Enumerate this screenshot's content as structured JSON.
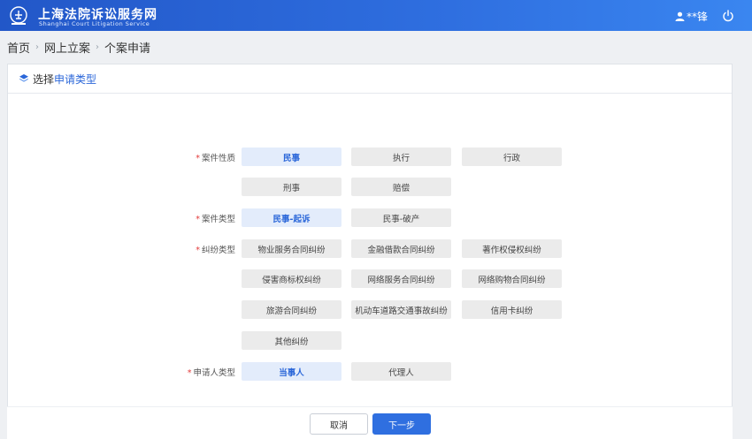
{
  "header": {
    "title_cn": "上海法院诉讼服务网",
    "title_en": "Shanghai Court Litigation Service",
    "user_name": "**锋",
    "logo_icon": "court-emblem-icon",
    "power_icon": "power-icon",
    "bg_color": "#2f6fe0"
  },
  "breadcrumb": {
    "items": [
      "首页",
      "网上立案",
      "个案申请"
    ]
  },
  "panel": {
    "title_plain": "选择",
    "title_accent": "申请类型",
    "accent_color": "#2b67d9"
  },
  "form": {
    "case_nature": {
      "label": "案件性质",
      "options": [
        "民事",
        "执行",
        "行政",
        "刑事",
        "赔偿"
      ],
      "selected": "民事"
    },
    "case_type": {
      "label": "案件类型",
      "options": [
        "民事-起诉",
        "民事-破产"
      ],
      "selected": "民事-起诉"
    },
    "dispute_type": {
      "label": "纠纷类型",
      "options": [
        "物业服务合同纠纷",
        "金融借款合同纠纷",
        "著作权侵权纠纷",
        "侵害商标权纠纷",
        "网络服务合同纠纷",
        "网络购物合同纠纷",
        "旅游合同纠纷",
        "机动车道路交通事故纠纷",
        "信用卡纠纷",
        "其他纠纷"
      ]
    },
    "applicant_type": {
      "label": "申请人类型",
      "options": [
        "当事人",
        "代理人"
      ],
      "selected": "当事人"
    },
    "required_mark": "*"
  },
  "footer": {
    "cancel_label": "取消",
    "next_label": "下一步"
  }
}
